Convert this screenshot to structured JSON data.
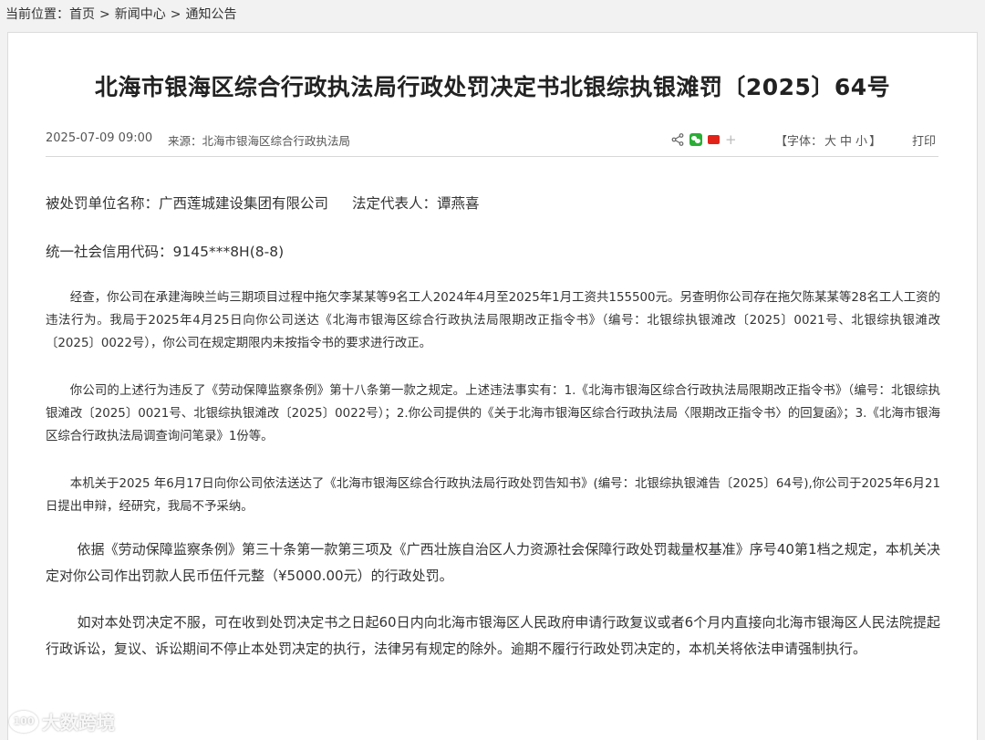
{
  "breadcrumb": {
    "prefix": "当前位置：",
    "items": [
      "首页",
      "新闻中心",
      "通知公告"
    ],
    "separator": ">"
  },
  "article": {
    "title": "北海市银海区综合行政执法局行政处罚决定书北银综执银滩罚〔2025〕64号",
    "date": "2025-07-09 09:00",
    "source": "来源：北海市银海区综合行政执法局",
    "font_size": {
      "prefix": "【字体：",
      "large": "大",
      "medium": "中",
      "small": "小",
      "suffix": "】"
    },
    "print_label": "打印",
    "share_plus": "+",
    "paragraphs": {
      "party": "被处罚单位名称：广西莲城建设集团有限公司",
      "legal_rep": "法定代表人：谭燕喜",
      "credit_code": "统一社会信用代码：9145***8H(8-8)",
      "p1": "经查，你公司在承建海映兰屿三期项目过程中拖欠李某某等9名工人2024年4月至2025年1月工资共155500元。另查明你公司存在拖欠陈某某等28名工人工资的违法行为。我局于2025年4月25日向你公司送达《北海市银海区综合行政执法局限期改正指令书》（编号：北银综执银滩改〔2025〕0021号、北银综执银滩改〔2025〕0022号），你公司在规定期限内未按指令书的要求进行改正。",
      "p2": "你公司的上述行为违反了《劳动保障监察条例》第十八条第一款之规定。上述违法事实有：1.《北海市银海区综合行政执法局限期改正指令书》（编号：北银综执银滩改〔2025〕0021号、北银综执银滩改〔2025〕0022号）；2.你公司提供的《关于北海市银海区综合行政执法局〈限期改正指令书〉的回复函》；3.《北海市银海区综合行政执法局调查询问笔录》1份等。",
      "p3": "本机关于2025 年6月17日向你公司依法送达了《北海市银海区综合行政执法局行政处罚告知书》(编号：北银综执银滩告〔2025〕64号),你公司于2025年6月21日提出申辩，经研究，我局不予采纳。",
      "p4": "依据《劳动保障监察条例》第三十条第一款第三项及《广西壮族自治区人力资源社会保障行政处罚裁量权基准》序号40第1档之规定，本机关决定对你公司作出罚款人民币伍仟元整（¥5000.00元）的行政处罚。",
      "p5": "如对本处罚决定不服，可在收到处罚决定书之日起60日内向北海市银海区人民政府申请行政复议或者6个月内直接向北海市银海区人民法院提起行政诉讼，复议、诉讼期间不停止本处罚决定的执行，法律另有规定的除外。逾期不履行行政处罚决定的，本机关将依法申请强制执行。"
    }
  },
  "watermark": {
    "logo": "100",
    "text": "大数跨境"
  },
  "icons": [
    "share-icon",
    "wechat-icon",
    "weibo-icon",
    "plus-icon"
  ],
  "colors": {
    "wechat": "#2aae35",
    "weibo": "#e2231a",
    "border": "#dcdcdc"
  }
}
